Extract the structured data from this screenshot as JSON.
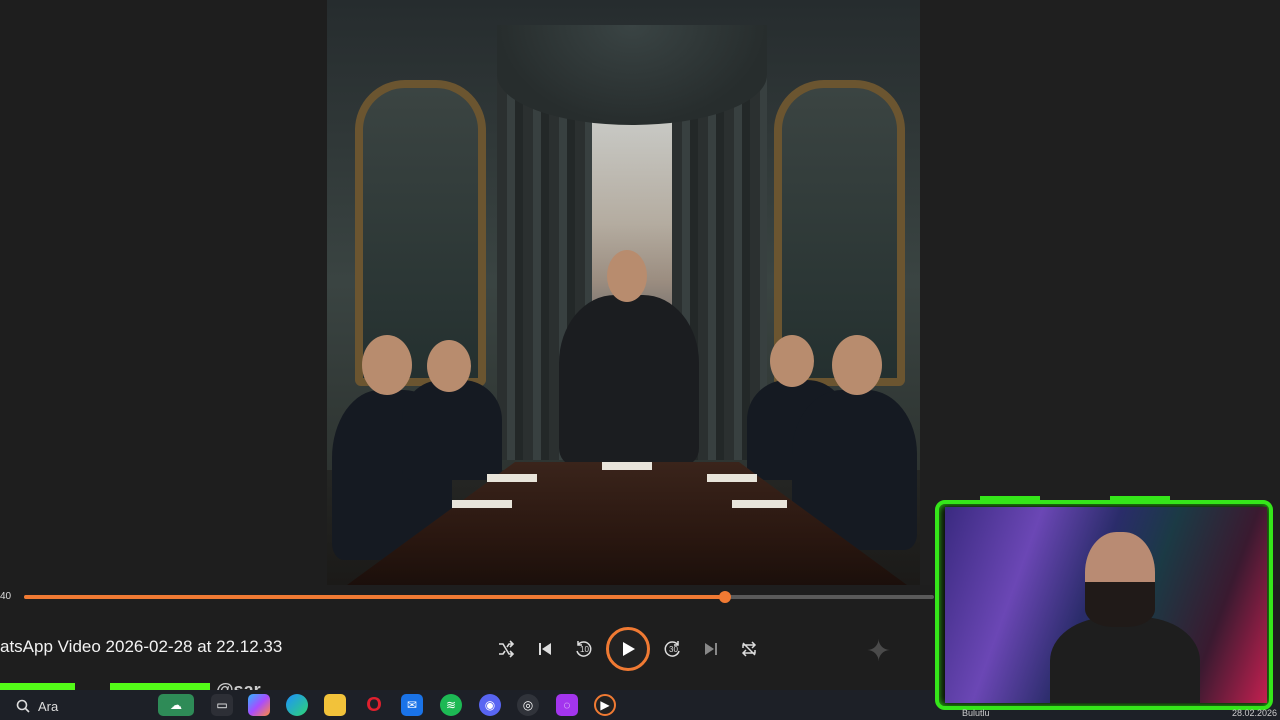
{
  "player": {
    "current_time": "40",
    "progress_fraction": 0.77,
    "title": "atsApp Video 2026-02-28 at 22.12.33",
    "controls": {
      "shuffle": "shuffle-icon",
      "previous": "previous-icon",
      "rewind_seconds": "10",
      "play": "play-icon",
      "forward_seconds": "30",
      "next": "next-icon",
      "repeat": "repeat-icon",
      "copilot": "sparkle-icon"
    },
    "accent_color": "#f07a33"
  },
  "taskbar": {
    "search_placeholder": "Ara",
    "icons": [
      "widgets-icon",
      "file-explorer-icon",
      "copilot-icon",
      "edge-icon",
      "folder-icon",
      "opera-icon",
      "outlook-icon",
      "spotify-icon",
      "discord-icon",
      "obs-icon",
      "podcast-icon",
      "media-player-icon"
    ],
    "clock_fragment": "28.02.2026",
    "status_fragment": "Bulutlu"
  },
  "overlay": {
    "stream_tag": "@sar",
    "frame_color": "#35e61a"
  }
}
